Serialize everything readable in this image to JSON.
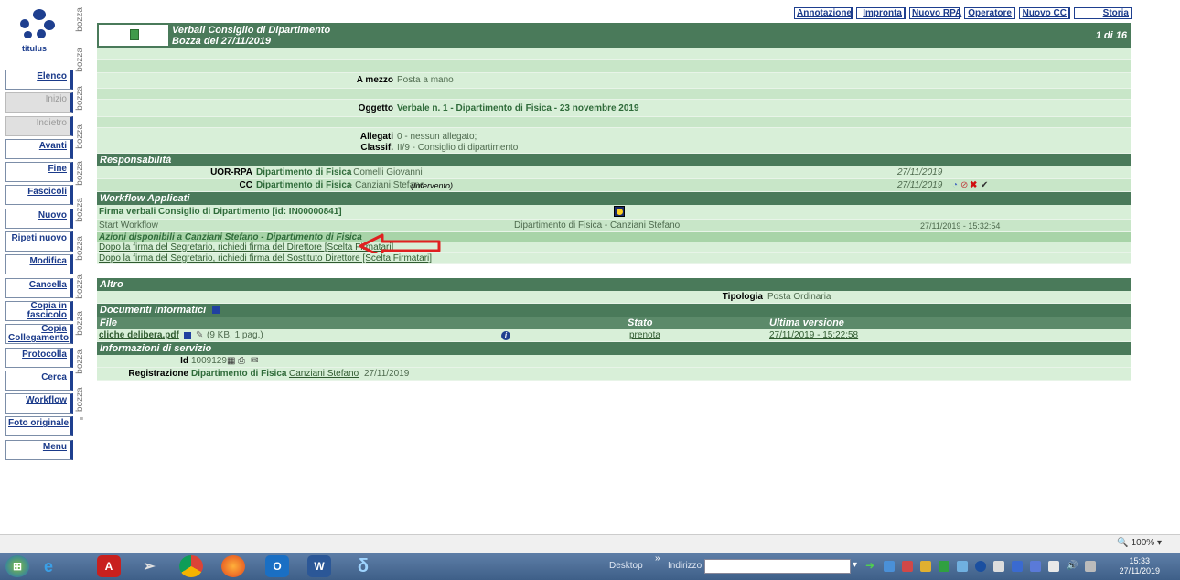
{
  "logo": {
    "label": "titulus"
  },
  "watermark": "bozza",
  "nav": [
    {
      "label": "Elenco",
      "enabled": true
    },
    {
      "label": "Inizio",
      "enabled": false
    },
    {
      "label": "Indietro",
      "enabled": false
    },
    {
      "label": "Avanti",
      "enabled": true
    },
    {
      "label": "Fine",
      "enabled": true
    },
    {
      "label": "Fascicoli",
      "enabled": true
    },
    {
      "label": "Nuovo",
      "enabled": true
    },
    {
      "label": "Ripeti nuovo",
      "enabled": true
    },
    {
      "label": "Modifica",
      "enabled": true
    },
    {
      "label": "Cancella",
      "enabled": true
    },
    {
      "label": "Copia in fascicolo",
      "enabled": true
    },
    {
      "label": "Copia Collegamento",
      "enabled": true
    },
    {
      "label": "Protocolla",
      "enabled": true
    },
    {
      "label": "Cerca",
      "enabled": true
    },
    {
      "label": "Workflow",
      "enabled": true
    },
    {
      "label": "Foto originale",
      "enabled": true
    },
    {
      "label": "Menu",
      "enabled": true
    }
  ],
  "toolbar": [
    "Annotazione",
    "Impronta",
    "Nuovo RPA",
    "Operatore",
    "Nuovo CC",
    "Storia"
  ],
  "header": {
    "title": "Verbali Consiglio di Dipartimento",
    "subtitle": "Bozza del 27/11/2019",
    "pager": "1 di 16"
  },
  "doc": {
    "mezzo_label": "A mezzo",
    "mezzo_value": "Posta a mano",
    "oggetto_label": "Oggetto",
    "oggetto_value": "Verbale n. 1  - Dipartimento di Fisica  - 23 novembre 2019",
    "allegati_label": "Allegati",
    "allegati_value": "0 - nessun allegato;",
    "classif_label": "Classif.",
    "classif_value": "II/9 - Consiglio di dipartimento"
  },
  "responsabilita": {
    "title": "Responsabilità",
    "uor_label": "UOR-RPA",
    "uor_dept": "Dipartimento di Fisica",
    "uor_person": "- Comelli Giovanni",
    "uor_date": "27/11/2019",
    "cc_label": "CC",
    "cc_dept": "Dipartimento di Fisica",
    "cc_person": "- Canziani Stefano",
    "cc_note": "(Intervento)",
    "cc_date": "27/11/2019"
  },
  "workflow": {
    "title": "Workflow Applicati",
    "name": "Firma verbali Consiglio di Dipartimento [id: IN00000841]",
    "start_label": "Start Workflow",
    "start_person": "Dipartimento di Fisica - Canziani Stefano",
    "start_date": "27/11/2019 - 15:32:54",
    "azioni_title": "Azioni disponibili a Canziani Stefano - Dipartimento di Fisica",
    "azione1": "Dopo la firma del Segretario, richiedi firma del Direttore [Scelta Firmatari]",
    "azione2": "Dopo la firma del Segretario, richiedi firma del Sostituto Direttore [Scelta Firmatari]"
  },
  "altro": {
    "title": "Altro",
    "tipologia_label": "Tipologia",
    "tipologia_value": "Posta Ordinaria"
  },
  "documenti": {
    "title": "Documenti informatici",
    "col_file": "File",
    "col_stato": "Stato",
    "col_versione": "Ultima versione",
    "file_name": "cliche delibera.pdf",
    "file_info": "(9 KB, 1 pag.)",
    "stato": "prenota",
    "versione": "27/11/2019 - 15:22:58"
  },
  "servizio": {
    "title": "Informazioni di servizio",
    "id_label": "Id",
    "id_value": "1009129",
    "reg_label": "Registrazione",
    "reg_dept": "Dipartimento di Fisica",
    "reg_person": "Canziani Stefano",
    "reg_date": "27/11/2019"
  },
  "statusbar": {
    "zoom": "100%"
  },
  "taskbar": {
    "desktop": "Desktop",
    "indirizzo": "Indirizzo",
    "time": "15:33",
    "date": "27/11/2019"
  },
  "colors": {
    "header_green": "#4a7a5a",
    "row_green": "#c8e6c8",
    "nav_blue": "#1e3f8f",
    "arrow_red": "#e02020"
  }
}
